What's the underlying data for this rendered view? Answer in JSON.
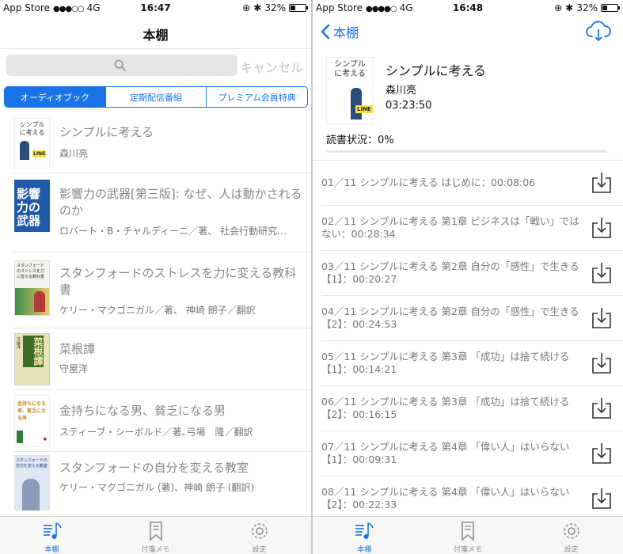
{
  "left": {
    "status": {
      "carrier": "App Store",
      "signal": "●●●○○",
      "network": "4G",
      "time": "16:47",
      "battery": "32%",
      "battery_level": 0.32
    },
    "nav": {
      "title": "本棚"
    },
    "search": {
      "placeholder": "",
      "cancel": "キャンセル",
      "icon": "search-icon"
    },
    "segments": [
      {
        "label": "オーディオブック",
        "active": true
      },
      {
        "label": "定期配信番組",
        "active": false
      },
      {
        "label": "プレミアム会員特典",
        "active": false
      }
    ],
    "books": [
      {
        "title": "シンプルに考える",
        "author": "森川亮"
      },
      {
        "title": "影響力の武器[第三版]: なぜ、人は動かされるのか",
        "author": "ロバート・B・チャルディーニ／著、 社会行動研究…"
      },
      {
        "title": "スタンフォードのストレスを力に変える教科書",
        "author": "ケリー・マクゴニガル／著、 神崎 朗子／翻訳"
      },
      {
        "title": "菜根譚",
        "author": "守屋洋"
      },
      {
        "title": "金持ちになる男、貧乏になる男",
        "author": "スティーブ・シーボルド／著､弓場　隆／翻訳"
      },
      {
        "title": "スタンフォードの自分を変える教室",
        "author": "ケリー・マクゴニガル (著)、神崎 朗子 (翻訳)"
      }
    ],
    "covers": [
      {
        "line1": "シンプル",
        "line2": "に考える",
        "badge": "LINE"
      },
      {
        "text": "影響力の武器"
      },
      {
        "text": "スタンフォードのストレスを力に変える教科書"
      },
      {
        "text": "菜根譚",
        "sub": "守屋洋"
      },
      {
        "text": "金持ちになる男、貧乏になる男"
      },
      {
        "text": "スタンフォードの自分を変える教室"
      }
    ]
  },
  "tabs": [
    {
      "label": "本棚",
      "icon": "music-note-list-icon",
      "active": true
    },
    {
      "label": "付箋メモ",
      "icon": "bookmark-icon",
      "active": false
    },
    {
      "label": "設定",
      "icon": "gear-icon",
      "active": false
    }
  ],
  "right": {
    "status": {
      "carrier": "App Store",
      "signal": "●●●●○",
      "network": "4G",
      "time": "16:48",
      "battery": "32%",
      "battery_level": 0.32
    },
    "nav": {
      "back": "本棚",
      "cloud_icon": "cloud-download-icon"
    },
    "book": {
      "title": "シンプルに考える",
      "author": "森川亮",
      "duration": "03:23:50",
      "progress_label": "読書状況：0%",
      "progress": 0,
      "cover": {
        "line1": "シンプル",
        "line2": "に考える",
        "badge": "LINE"
      }
    },
    "chapters": [
      "01／11 シンプルに考える はじめに：00:08:06",
      "02／11 シンプルに考える 第1章 ビジネスは「戦い」ではない：00:28:34",
      "03／11 シンプルに考える 第2章 自分の「感性」で生きる【1】：00:20:27",
      "04／11 シンプルに考える 第2章 自分の「感性」で生きる【2】：00:24:53",
      "05／11 シンプルに考える 第3章 「成功」は捨て続ける【1】：00:14:21",
      "06／11 シンプルに考える 第3章 「成功」は捨て続ける【2】：00:16:15",
      "07／11 シンプルに考える 第4章 「偉い人」はいらない【1】：00:09:31",
      "08／11 シンプルに考える 第4章 「偉い人」はいらない【2】：00:22:33"
    ]
  },
  "colors": {
    "accent": "#1a73e8",
    "muted": "#888888"
  }
}
